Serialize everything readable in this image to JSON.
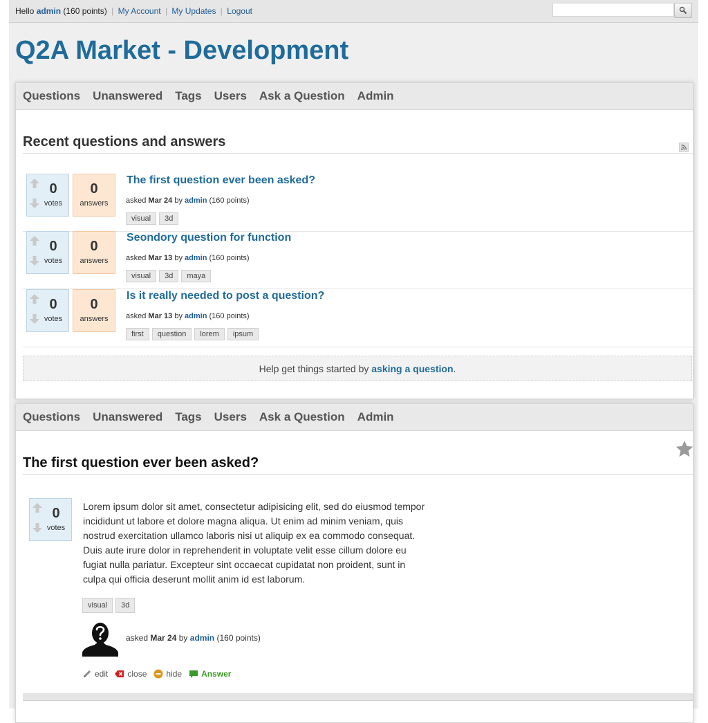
{
  "topbar": {
    "hello": "Hello",
    "username": "admin",
    "points": "(160 points)",
    "links": [
      "My Account",
      "My Updates",
      "Logout"
    ],
    "search_placeholder": ""
  },
  "site_title": "Q2A Market - Development",
  "nav": [
    "Questions",
    "Unanswered",
    "Tags",
    "Users",
    "Ask a Question",
    "Admin"
  ],
  "recent": {
    "title": "Recent questions and answers",
    "questions": [
      {
        "title": "The first question ever been asked?",
        "votes": "0",
        "votes_label": "votes",
        "answers": "0",
        "answers_label": "answers",
        "asked": "asked",
        "date": "Mar 24",
        "by": "by",
        "user": "admin",
        "points": "(160 points)",
        "tags": [
          "visual",
          "3d"
        ]
      },
      {
        "title": "Seondory question for function",
        "votes": "0",
        "votes_label": "votes",
        "answers": "0",
        "answers_label": "answers",
        "asked": "asked",
        "date": "Mar 13",
        "by": "by",
        "user": "admin",
        "points": "(160 points)",
        "tags": [
          "visual",
          "3d",
          "maya"
        ]
      },
      {
        "title": "Is it really needed to post a question?",
        "votes": "0",
        "votes_label": "votes",
        "answers": "0",
        "answers_label": "answers",
        "asked": "asked",
        "date": "Mar 13",
        "by": "by",
        "user": "admin",
        "points": "(160 points)",
        "tags": [
          "first",
          "question",
          "lorem",
          "ipsum"
        ]
      }
    ],
    "help": {
      "prefix": "Help get things started by",
      "link": "asking a question",
      "suffix": "."
    }
  },
  "question": {
    "title": "The first question ever been asked?",
    "votes": "0",
    "votes_label": "votes",
    "body": "Lorem ipsum dolor sit amet, consectetur adipisicing elit, sed do eiusmod tempor incididunt ut labore et dolore magna aliqua. Ut enim ad minim veniam, quis nostrud exercitation ullamco laboris nisi ut aliquip ex ea commodo consequat. Duis aute irure dolor in reprehenderit in voluptate velit esse cillum dolore eu fugiat nulla pariatur. Excepteur sint occaecat cupidatat non proident, sunt in culpa qui officia deserunt mollit anim id est laborum.",
    "tags": [
      "visual",
      "3d"
    ],
    "asked": "asked",
    "date": "Mar 24",
    "by": "by",
    "user": "admin",
    "points": "(160 points)",
    "actions": {
      "edit": "edit",
      "close": "close",
      "hide": "hide",
      "answer": "Answer"
    }
  },
  "colors": {
    "title_blue": "#1f6b9a",
    "link_blue": "#1f5e98",
    "votes_bg": "#e3eff7",
    "answers_bg": "#fde7d3",
    "answer_green": "#3a9b2a"
  }
}
